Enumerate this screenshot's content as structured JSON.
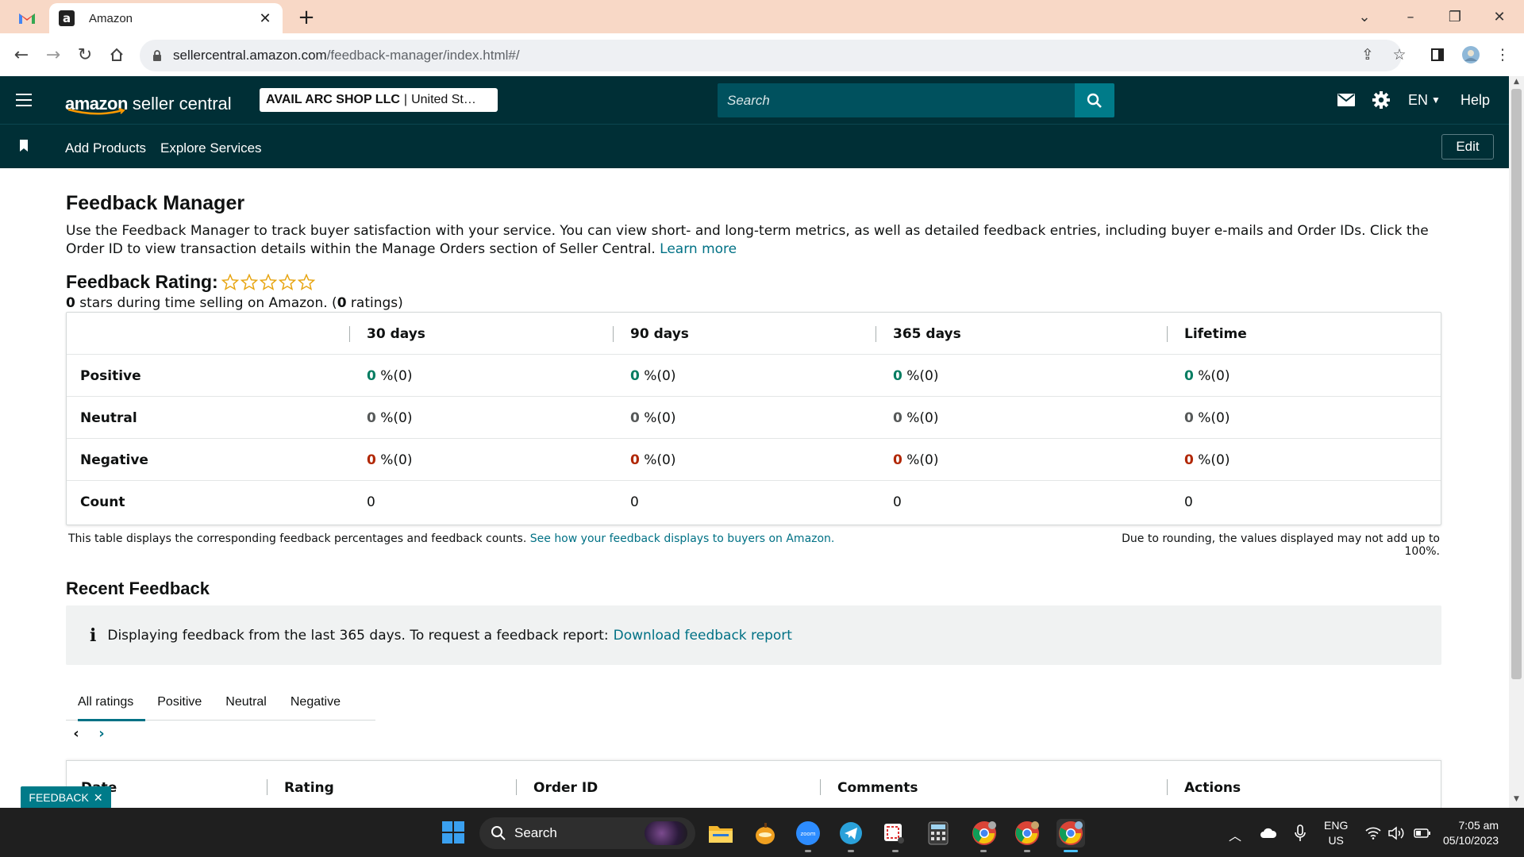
{
  "browser": {
    "tab_title": "Amazon",
    "favicon_letter": "a",
    "url_host": "sellercentral.amazon.com",
    "url_path": "/feedback-manager/index.html#/"
  },
  "header": {
    "logo_brand": "amazon",
    "logo_product": "seller central",
    "account_name": "AVAIL ARC SHOP LLC",
    "account_region": "United St…",
    "search_placeholder": "Search",
    "language": "EN",
    "help": "Help"
  },
  "subnav": {
    "items": [
      "Add Products",
      "Explore Services"
    ],
    "edit": "Edit"
  },
  "page": {
    "title": "Feedback Manager",
    "intro": "Use the Feedback Manager to track buyer satisfaction with your service. You can view short- and long-term metrics, as well as detailed feedback entries, including buyer e-mails and Order IDs. Click the Order ID to view transaction details within the Manage Orders section of Seller Central.",
    "learn_more": "Learn more",
    "rating_title": "Feedback Rating:",
    "rating_stars_filled": 0,
    "rating_stars_total": 5,
    "summary_stars": "0",
    "summary_mid": " stars during time selling on Amazon. (",
    "summary_ratings": "0",
    "summary_end": " ratings)"
  },
  "metrics": {
    "columns": [
      "30 days",
      "90 days",
      "365 days",
      "Lifetime"
    ],
    "rows": [
      {
        "label": "Positive",
        "tone": "green",
        "values": [
          "0",
          "0",
          "0",
          "0"
        ],
        "suffix": " %(0)"
      },
      {
        "label": "Neutral",
        "tone": "gray",
        "values": [
          "0",
          "0",
          "0",
          "0"
        ],
        "suffix": " %(0)"
      },
      {
        "label": "Negative",
        "tone": "red",
        "values": [
          "0",
          "0",
          "0",
          "0"
        ],
        "suffix": " %(0)"
      },
      {
        "label": "Count",
        "tone": "plain",
        "values": [
          "0",
          "0",
          "0",
          "0"
        ],
        "suffix": ""
      }
    ],
    "note": "This table displays the corresponding feedback percentages and feedback counts.",
    "note_link": "See how your feedback displays to buyers on Amazon.",
    "rounding_note": "Due to rounding, the values displayed may not add up to 100%."
  },
  "recent": {
    "title": "Recent Feedback",
    "info_text": "Displaying feedback from the last 365 days. To request a feedback report:",
    "info_link": "Download feedback report",
    "tabs": [
      "All ratings",
      "Positive",
      "Neutral",
      "Negative"
    ],
    "active_tab": "All ratings",
    "list_columns": [
      "Date",
      "Rating",
      "Order ID",
      "Comments",
      "Actions"
    ]
  },
  "feedback_button": "FEEDBACK",
  "taskbar": {
    "search_label": "Search",
    "lang_line1": "ENG",
    "lang_line2": "US",
    "time": "7:05 am",
    "date": "05/10/2023"
  },
  "colors": {
    "header_bg": "#002f36",
    "search_bg": "#00515e",
    "search_btn": "#007b89",
    "link": "#007185",
    "positive": "#067d62",
    "negative": "#b12704",
    "star": "#e7a40f"
  }
}
